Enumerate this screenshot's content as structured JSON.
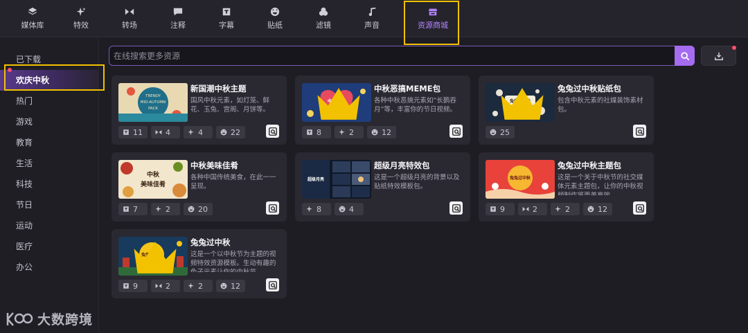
{
  "tabs": [
    {
      "label": "媒体库",
      "icon": "layers-icon"
    },
    {
      "label": "特效",
      "icon": "sparkle-icon"
    },
    {
      "label": "转场",
      "icon": "transition-icon"
    },
    {
      "label": "注释",
      "icon": "comment-icon"
    },
    {
      "label": "字幕",
      "icon": "subtitle-icon"
    },
    {
      "label": "贴纸",
      "icon": "sticker-icon"
    },
    {
      "label": "滤镜",
      "icon": "filter-icon"
    },
    {
      "label": "声音",
      "icon": "music-icon"
    },
    {
      "label": "资源商城",
      "icon": "store-icon",
      "active": true
    }
  ],
  "sidebar": {
    "items": [
      "已下载",
      "欢庆中秋",
      "热门",
      "游戏",
      "教育",
      "生活",
      "科技",
      "节日",
      "运动",
      "医疗",
      "办公"
    ],
    "active_index": 1
  },
  "search": {
    "placeholder": "在线搜索更多资源",
    "value": ""
  },
  "cards": [
    {
      "title": "新国潮中秋主题",
      "desc": "国风中秋元素，如灯笼、鲜花、玉兔、宫阁、月饼等。",
      "thumb_text": "TRENDY MID-AUTUMN PACK",
      "premium": false,
      "stats": [
        {
          "icon": "subtitle-icon",
          "value": "11"
        },
        {
          "icon": "transition-icon",
          "value": "4"
        },
        {
          "icon": "sparkle-icon",
          "value": "4"
        },
        {
          "icon": "sticker-icon",
          "value": "22"
        }
      ]
    },
    {
      "title": "中秋恶搞MEME包",
      "desc": "各种中秋恶搞元素如“长鹅吞月”等，丰富你的节日视频。",
      "thumb_text": "中秋恶搞 MEME包",
      "premium": true,
      "stats": [
        {
          "icon": "subtitle-icon",
          "value": "8"
        },
        {
          "icon": "sparkle-icon",
          "value": "2"
        },
        {
          "icon": "sticker-icon",
          "value": "12"
        }
      ]
    },
    {
      "title": "兔兔过中秋贴纸包",
      "desc": "包含中秋元素的社媒装饰素材包。",
      "thumb_text": "兔兔过中秋",
      "premium": true,
      "stats": [
        {
          "icon": "sticker-icon",
          "value": "25"
        }
      ]
    },
    {
      "title": "中秋美味佳肴",
      "desc": "各种中国传统美食，在此一一呈现。",
      "thumb_text": "中秋 美味佳肴",
      "premium": false,
      "stats": [
        {
          "icon": "subtitle-icon",
          "value": "7"
        },
        {
          "icon": "sparkle-icon",
          "value": "2"
        },
        {
          "icon": "sticker-icon",
          "value": "20"
        }
      ]
    },
    {
      "title": "超级月亮特效包",
      "desc": "这是一个超级月亮的背景以及贴纸特效模板包。",
      "thumb_text": "超级月亮",
      "premium": false,
      "stats": [
        {
          "icon": "sparkle-icon",
          "value": "8"
        },
        {
          "icon": "sticker-icon",
          "value": "4"
        }
      ]
    },
    {
      "title": "兔兔过中秋主题包",
      "desc": "这是一个关于中秋节的社交媒体元素主题包，让你的中秋视频制作将更美高效。",
      "thumb_text": "兔兔过中秋",
      "premium": false,
      "stats": [
        {
          "icon": "subtitle-icon",
          "value": "9"
        },
        {
          "icon": "transition-icon",
          "value": "2"
        },
        {
          "icon": "sparkle-icon",
          "value": "2"
        },
        {
          "icon": "sticker-icon",
          "value": "12"
        }
      ]
    },
    {
      "title": "兔兔过中秋",
      "desc": "这是一个以中秋节为主题的视频特效资源模板。生动有趣的兔子元素让你的中秋节。",
      "thumb_text": "兔兔过中秋",
      "premium": true,
      "stats": [
        {
          "icon": "subtitle-icon",
          "value": "9"
        },
        {
          "icon": "transition-icon",
          "value": "2"
        },
        {
          "icon": "sparkle-icon",
          "value": "2"
        },
        {
          "icon": "sticker-icon",
          "value": "12"
        }
      ]
    }
  ],
  "watermark": "大数跨境",
  "colors": {
    "accent": "#a56cf0",
    "highlight": "#f2c200",
    "background": "#1e1d24",
    "card": "#2a2931"
  }
}
